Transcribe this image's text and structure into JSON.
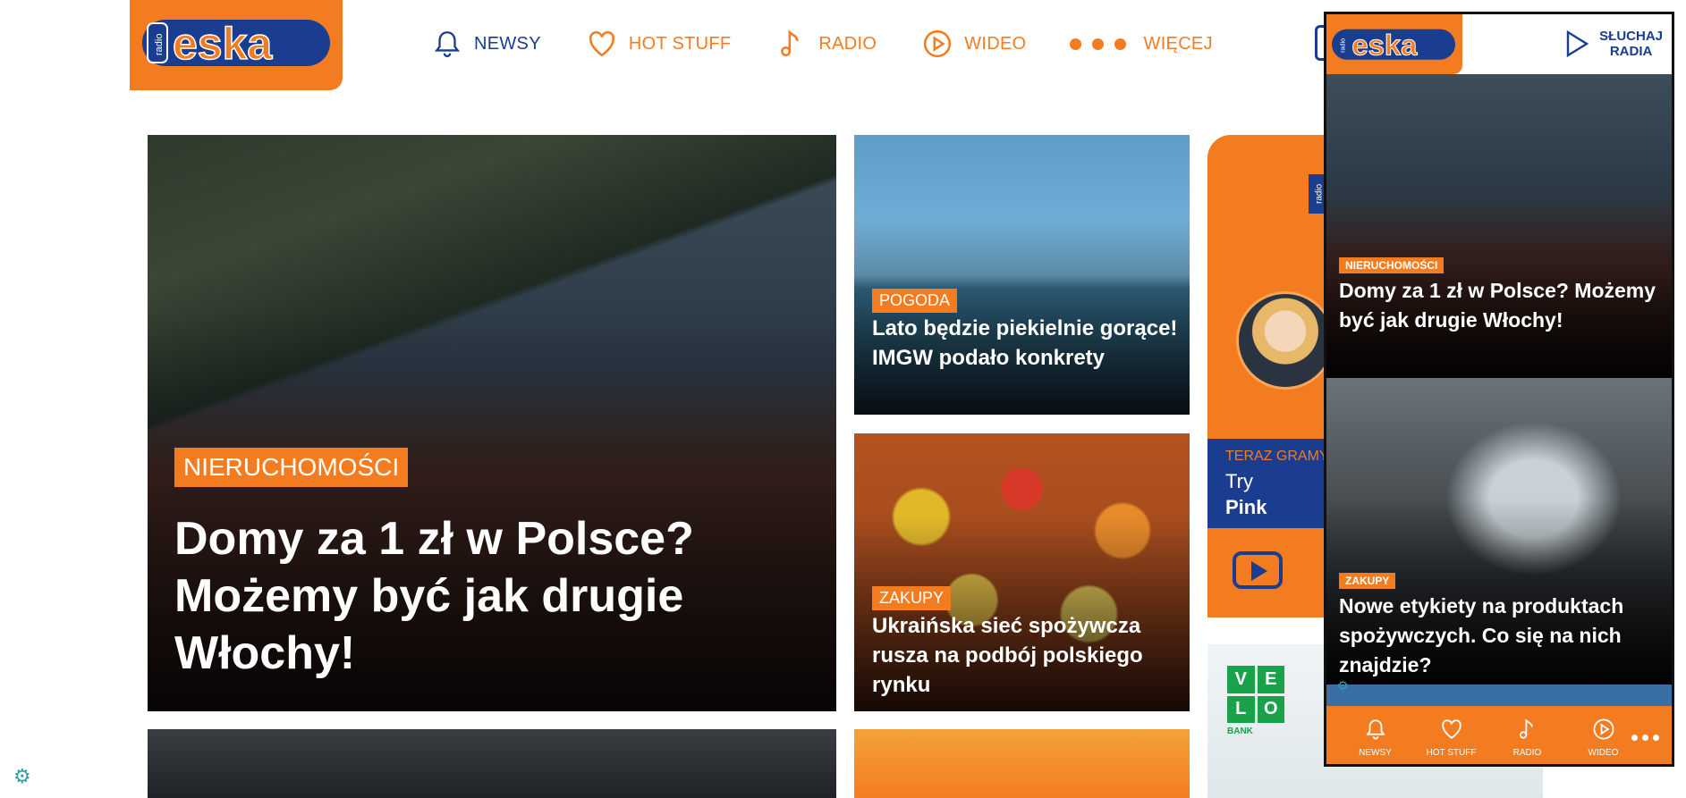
{
  "brand": {
    "logo_small": "radio",
    "logo_text": "eska",
    "colors": {
      "orange": "#f47c20",
      "navy": "#1a3d8f",
      "white": "#ffffff"
    }
  },
  "nav": {
    "items": [
      {
        "label": "NEWSY",
        "icon": "bell-icon"
      },
      {
        "label": "HOT STUFF",
        "icon": "heart-icon"
      },
      {
        "label": "RADIO",
        "icon": "music-note-icon"
      },
      {
        "label": "WIDEO",
        "icon": "play-circle-icon"
      },
      {
        "label": "WIĘCEJ",
        "icon": "dots-icon"
      }
    ]
  },
  "featured": {
    "tag": "NIERUCHOMOŚCI",
    "title": "Domy za 1 zł w Polsce? Możemy być jak drugie Włochy!"
  },
  "side_articles": [
    {
      "tag": "POGODA",
      "title": "Lato będzie piekielnie gorące! IMGW podało konkrety"
    },
    {
      "tag": "ZAKUPY",
      "title": "Ukraińska sieć spożywcza rusza na podbój polskiego rynku"
    }
  ],
  "radio_widget": {
    "badge": "radio",
    "now_playing_label": "TERAZ GRAMY",
    "artist": "Try",
    "song": "Pink"
  },
  "ad": {
    "letters": [
      "V",
      "E",
      "L",
      "O"
    ],
    "subtitle": "BANK"
  },
  "mobile": {
    "listen_label_line1": "SŁUCHAJ",
    "listen_label_line2": "RADIA",
    "articles": [
      {
        "tag": "NIERUCHOMOŚCI",
        "title": "Domy za 1 zł w Polsce? Możemy być jak drugie Włochy!"
      },
      {
        "tag": "ZAKUPY",
        "title": "Nowe etykiety na produktach spożywczych. Co się na nich znajdzie?"
      }
    ],
    "tabs": [
      {
        "label": "NEWSY",
        "icon": "bell-icon"
      },
      {
        "label": "HOT STUFF",
        "icon": "heart-icon"
      },
      {
        "label": "RADIO",
        "icon": "music-note-icon"
      },
      {
        "label": "WIDEO",
        "icon": "play-circle-icon"
      }
    ]
  }
}
